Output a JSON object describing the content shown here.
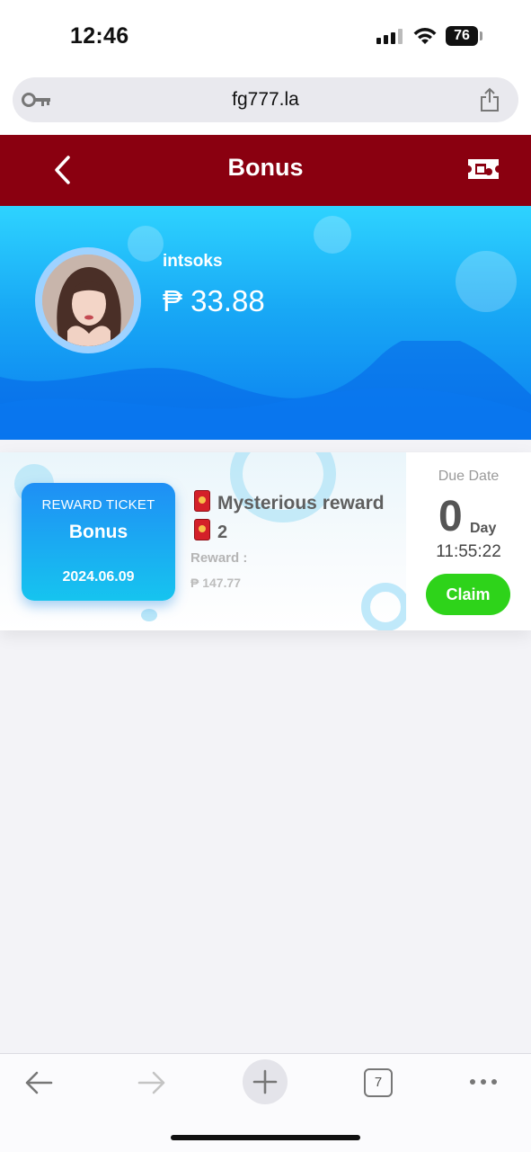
{
  "status_bar": {
    "time": "12:46",
    "battery": "76"
  },
  "browser": {
    "url": "fg777.la",
    "tab_count": "7"
  },
  "header": {
    "title": "Bonus"
  },
  "profile": {
    "username": "intsoks",
    "balance": "₱ 33.88"
  },
  "ticket": {
    "kicker": "REWARD TICKET",
    "name": "Bonus",
    "date": "2024.06.09",
    "reward_title": "Mysterious reward",
    "reward_count": "2",
    "reward_label": "Reward :",
    "reward_value": "₱ 147.77",
    "due_label": "Due Date",
    "due_days": "0",
    "due_unit": "Day",
    "due_time": "11:55:22",
    "claim_label": "Claim"
  },
  "colors": {
    "header_bg": "#8a0010",
    "banner_top": "#2ed3ff",
    "banner_bottom": "#0b7ef0",
    "claim_bg": "#2ed31a"
  },
  "icons": [
    "key-icon",
    "share-icon",
    "back-icon",
    "ticket-icon",
    "red-envelope-icon",
    "back-arrow-icon",
    "forward-arrow-icon",
    "plus-icon",
    "tabs-icon",
    "more-icon"
  ]
}
